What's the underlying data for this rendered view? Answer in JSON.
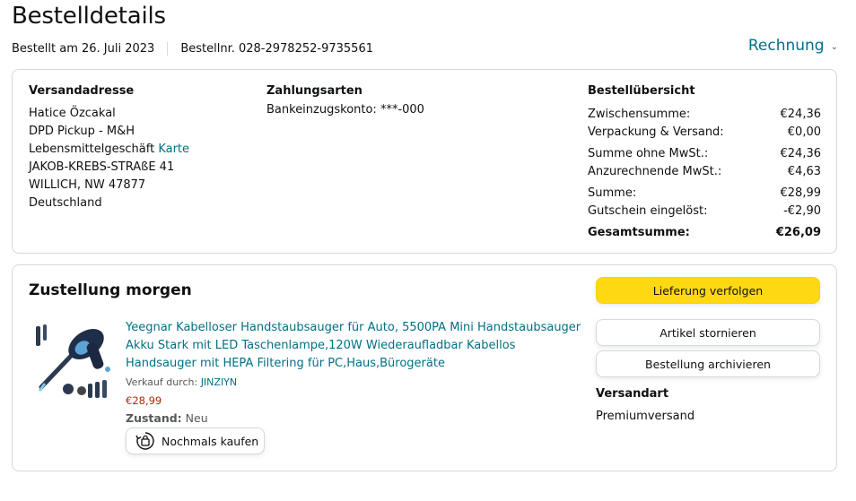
{
  "page": {
    "title": "Bestelldetails",
    "order_date": "Bestellt am 26. Juli 2023",
    "order_number": "Bestellnr. 028-2978252-9735561",
    "invoice_label": "Rechnung",
    "invoice_icon": "chevron-down-icon"
  },
  "shipping": {
    "heading": "Versandadresse",
    "name": "Hatice Özcakal",
    "line1": "DPD Pickup - M&H",
    "line2": "Lebensmittelgeschäft",
    "map_link": "Karte",
    "street": "JAKOB-KREBS-STRAßE 41",
    "city": "WILLICH, NW 47877",
    "country": "Deutschland"
  },
  "payment": {
    "heading": "Zahlungsarten",
    "method": "Bankeinzugskonto: ***-000"
  },
  "summary": {
    "heading": "Bestellübersicht",
    "rows": [
      {
        "label": "Zwischensumme:",
        "value": "€24,36"
      },
      {
        "label": "Verpackung & Versand:",
        "value": "€0,00"
      },
      {
        "label": "Summe ohne MwSt.:",
        "value": "€24,36"
      },
      {
        "label": "Anzurechnende MwSt.:",
        "value": "€4,63"
      },
      {
        "label": "Summe:",
        "value": "€28,99"
      },
      {
        "label": "Gutschein eingelöst:",
        "value": "-€2,90"
      },
      {
        "label": "Gesamtsumme:",
        "value": "€26,09"
      }
    ]
  },
  "delivery": {
    "title": "Zustellung morgen",
    "product": {
      "title": "Yeegnar Kabelloser Handstaubsauger für Auto, 5500PA Mini Handstaubsauger Akku Stark mit LED Taschenlampe,120W Wiederaufladbar Kabellos Handsauger mit HEPA Filtering für PC,Haus,Bürogeräte",
      "seller_label": "Verkauf durch:",
      "seller_name": "JINZIYN",
      "price": "€28,99",
      "condition_label": "Zustand:",
      "condition_value": "Neu",
      "buy_again_label": "Nochmals kaufen",
      "buy_again_icon": "rebuy-icon"
    },
    "actions": {
      "track": "Lieferung verfolgen",
      "cancel": "Artikel stornieren",
      "archive": "Bestellung archivieren"
    },
    "shipping_method_heading": "Versandart",
    "shipping_method_value": "Premiumversand"
  },
  "colors": {
    "link": "#007185",
    "price": "#b12704",
    "primary_button": "#ffd814",
    "border": "#d5d9d9"
  }
}
